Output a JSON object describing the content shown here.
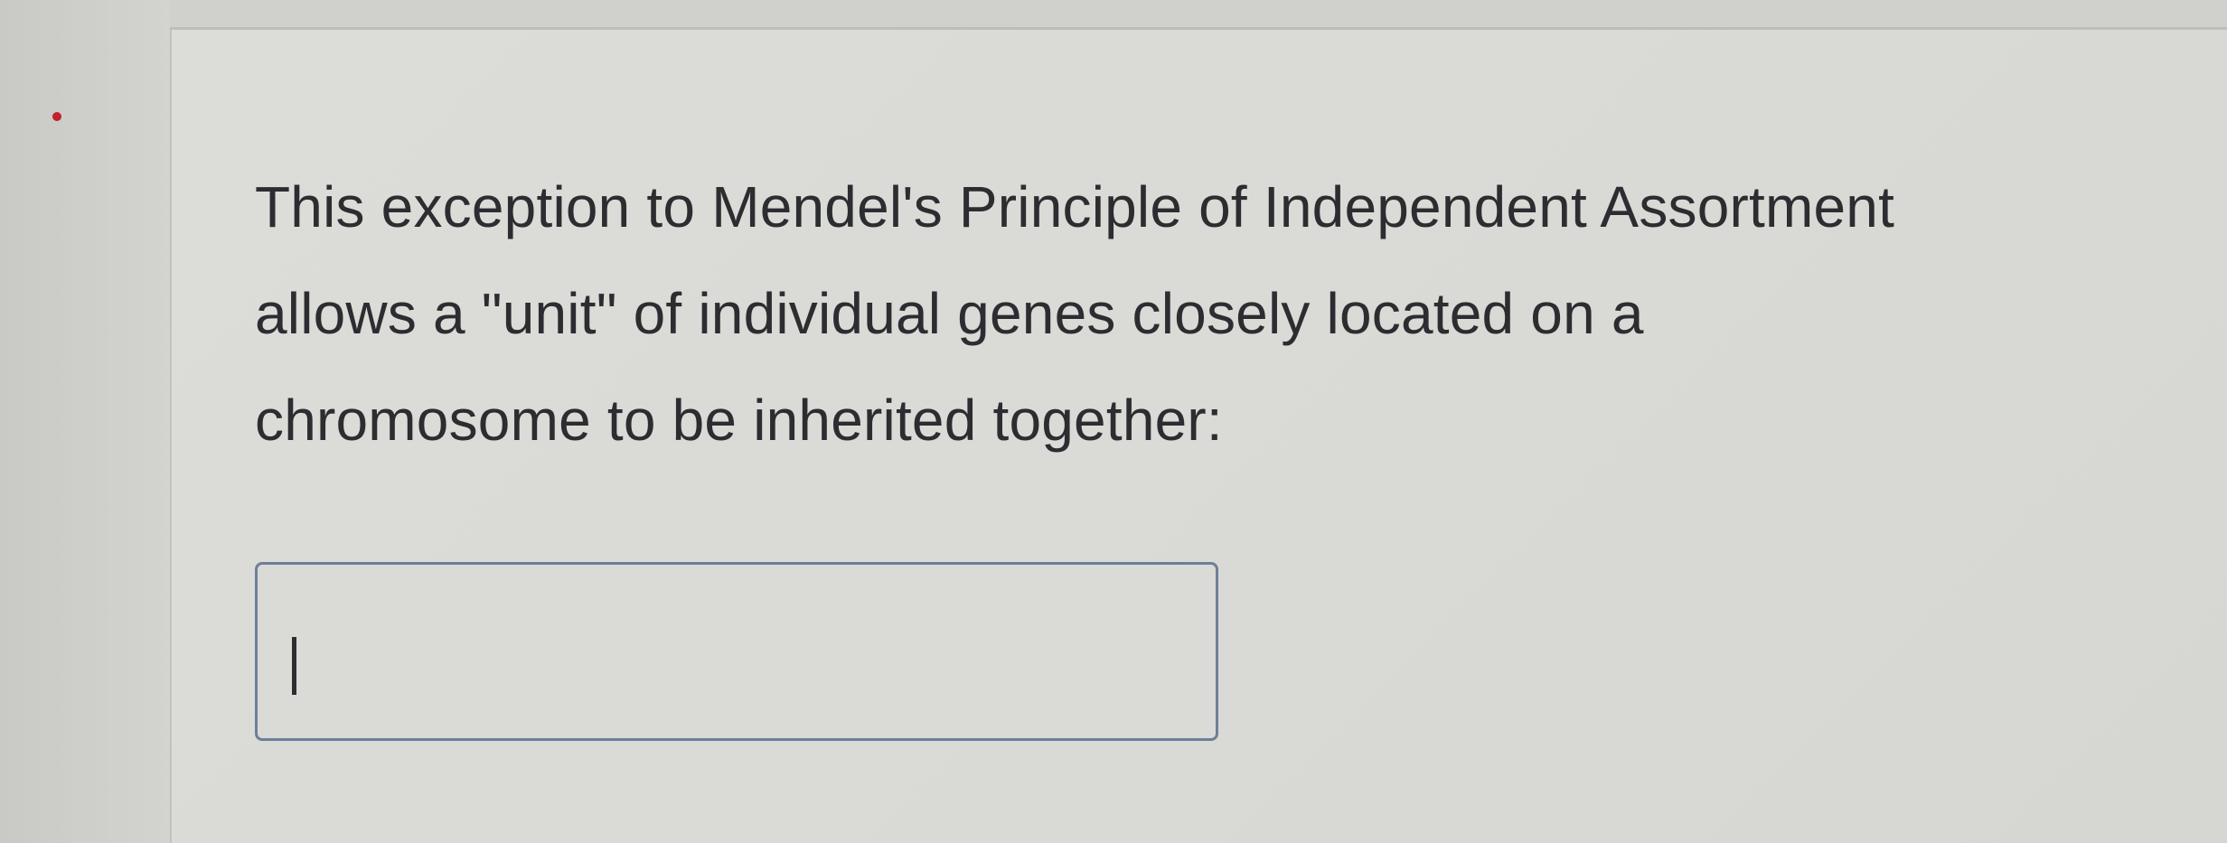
{
  "question": {
    "text": "This exception to Mendel's Principle of Independent Assortment\nallows a \"unit\" of individual genes closely located on a\nchromosome to be inherited together:"
  },
  "answer": {
    "value": "",
    "placeholder": ""
  },
  "colors": {
    "text": "#2c2d31",
    "input_border": "#6d7f99",
    "background": "#dcdcd8",
    "marker": "#c0222f"
  }
}
